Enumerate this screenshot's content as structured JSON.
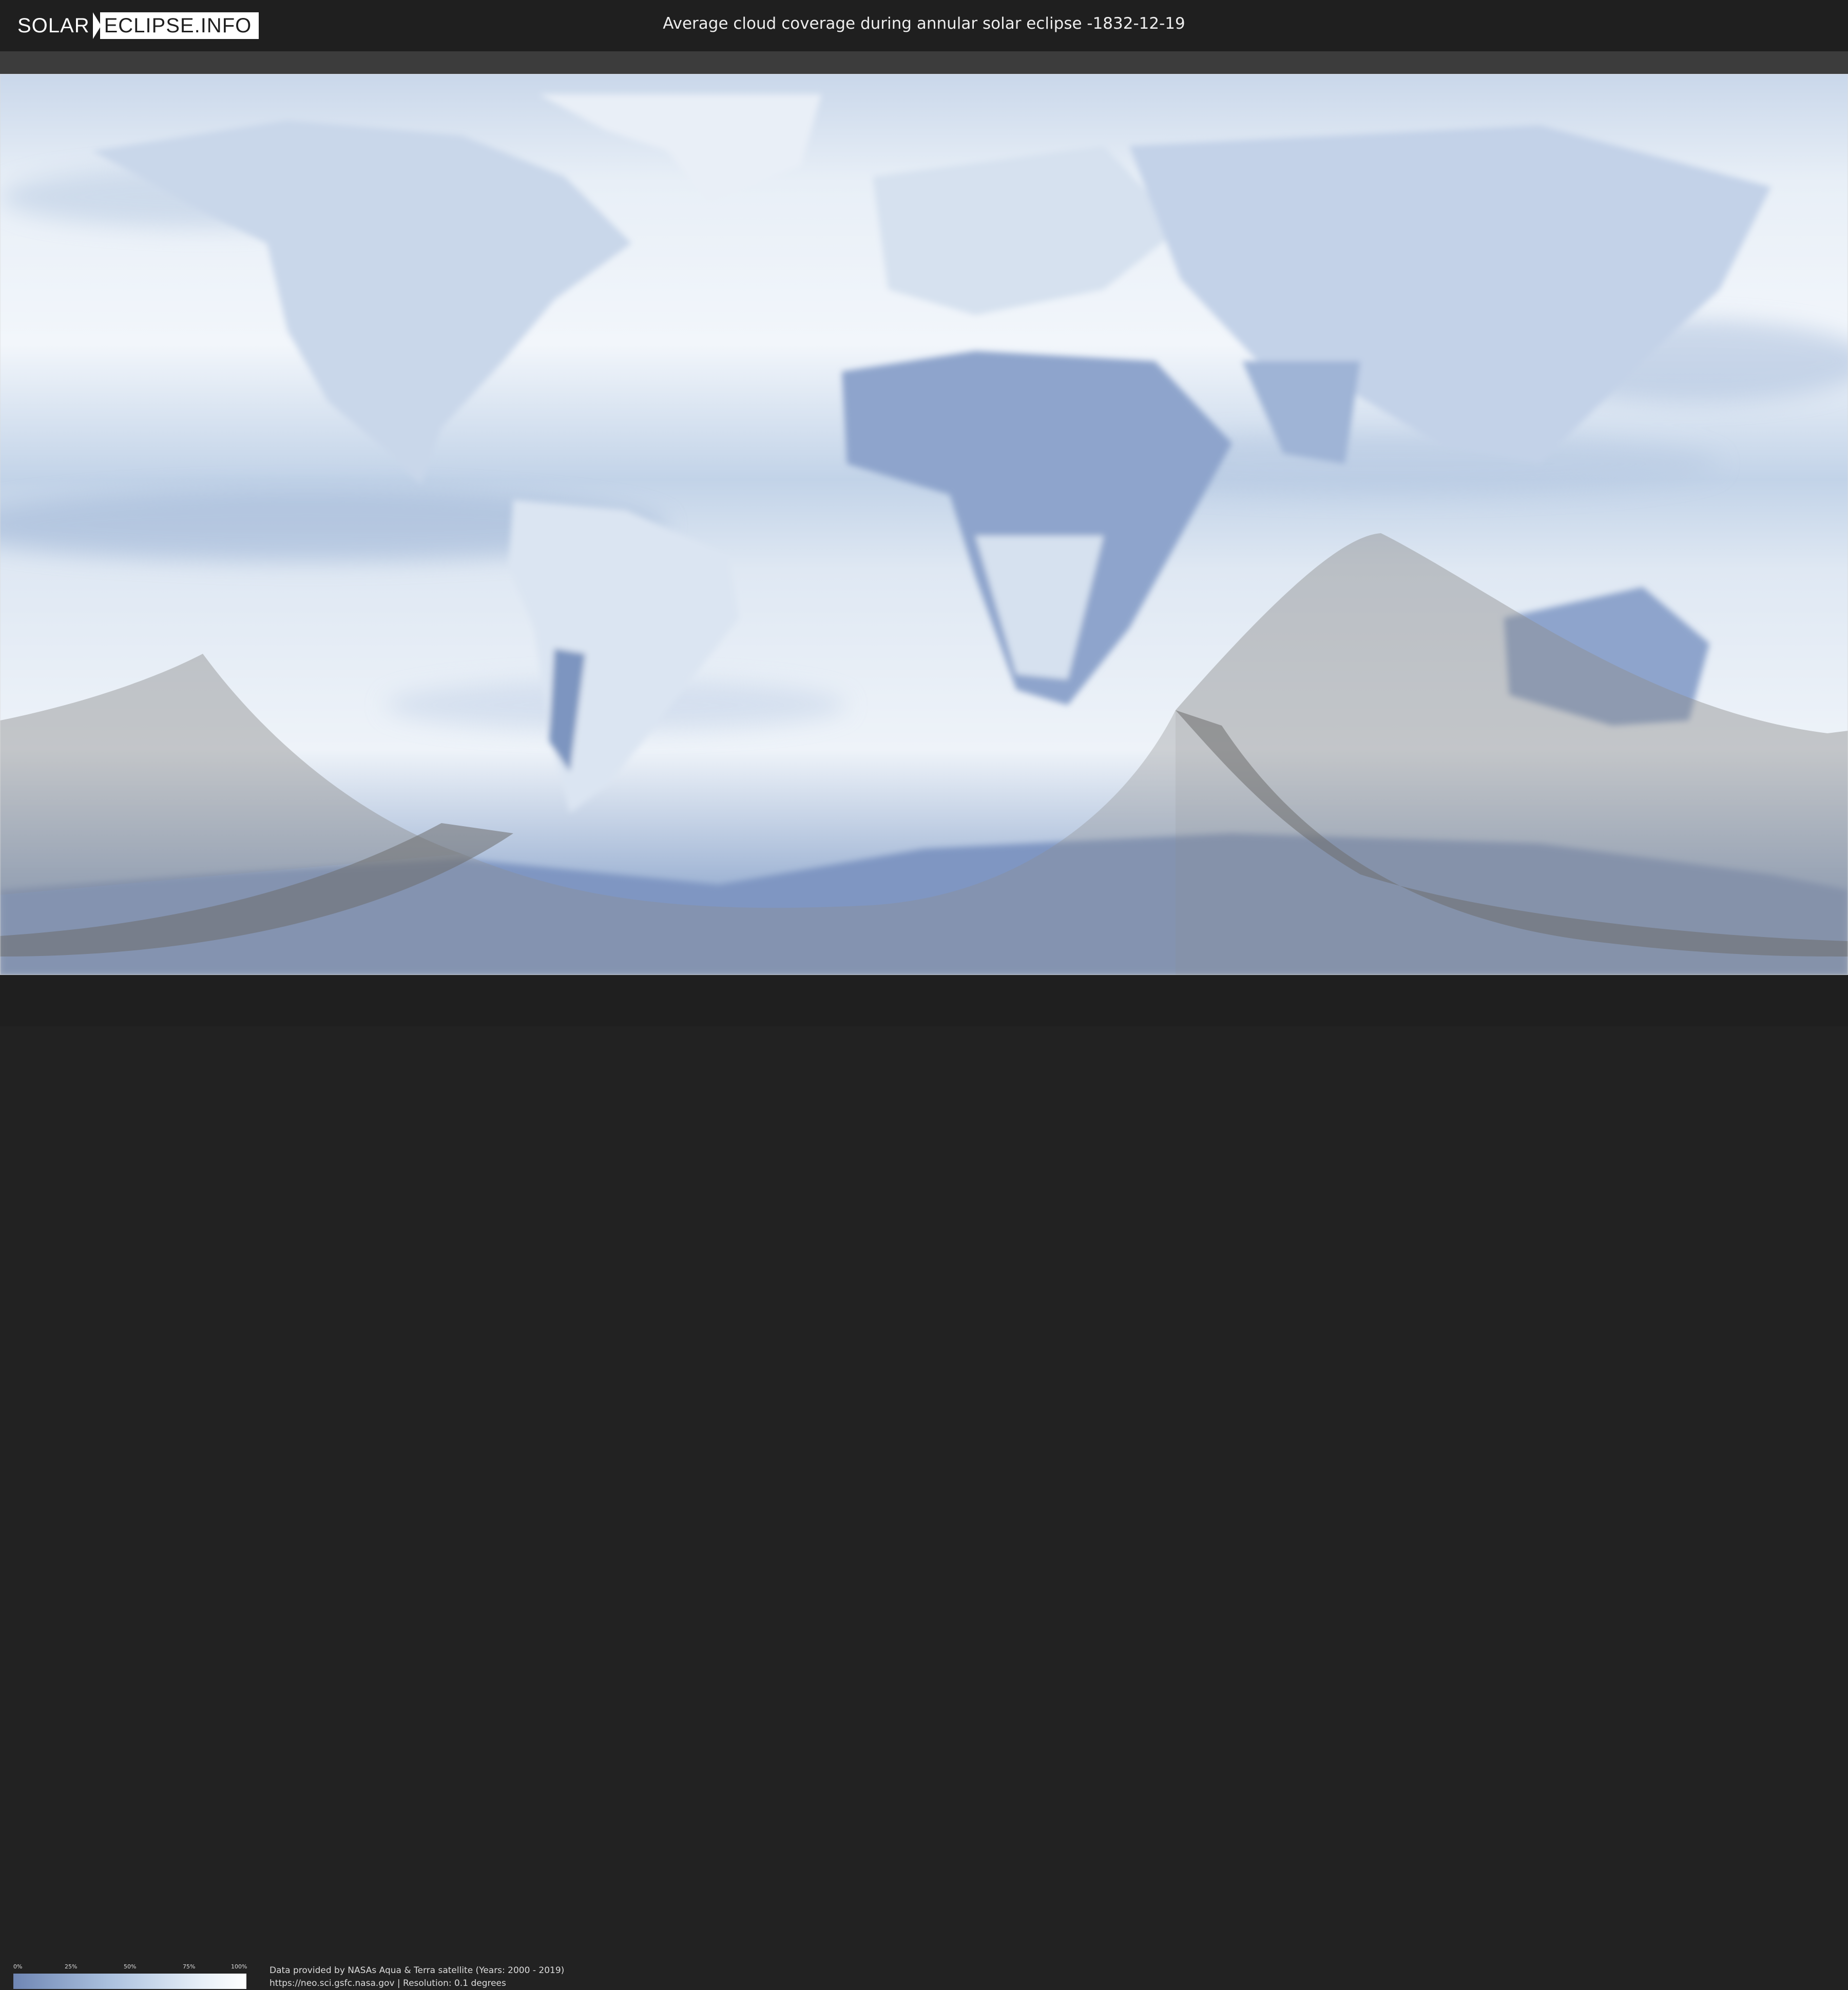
{
  "header": {
    "logo_left": "SOLAR",
    "logo_right": "ECLIPSE.INFO",
    "title": "Average cloud coverage during annular solar eclipse -1832-12-19"
  },
  "legend": {
    "labels": [
      "0%",
      "25%",
      "50%",
      "75%",
      "100%"
    ],
    "colors": [
      "#6f86b4",
      "#a9bfdd",
      "#e6eef7",
      "#ffffff"
    ]
  },
  "footer": {
    "credit_line1": "Data provided by NASAs Aqua & Terra satellite (Years: 2000 - 2019)",
    "credit_line2": "https://neo.sci.gsfc.nasa.gov | Resolution: 0.1 degrees"
  },
  "map": {
    "background": "cloud-coverage",
    "cloud_color_low": "#6f86b4",
    "cloud_color_high": "#ffffff",
    "shadow_color": "#9a9a9a"
  }
}
